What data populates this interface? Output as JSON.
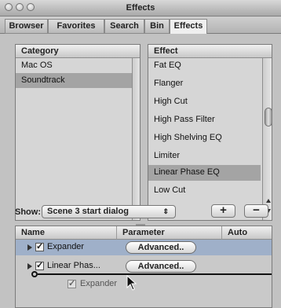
{
  "window": {
    "title": "Effects"
  },
  "tabs": [
    {
      "label": "Browser"
    },
    {
      "label": "Favorites"
    },
    {
      "label": "Search"
    },
    {
      "label": "Bin"
    },
    {
      "label": "Effects",
      "active": true
    }
  ],
  "category_list": {
    "header": "Category",
    "items": [
      "Mac OS",
      "Soundtrack"
    ],
    "selected_index": 1
  },
  "effect_list": {
    "header": "Effect",
    "items": [
      "Fat EQ",
      "Flanger",
      "High Cut",
      "High Pass Filter",
      "High Shelving EQ",
      "Limiter",
      "Linear Phase EQ",
      "Low Cut"
    ],
    "selected_index": 6
  },
  "show": {
    "label": "Show:",
    "value": "Scene 3 start dialog",
    "add_label": "+",
    "remove_label": "−"
  },
  "effects_table": {
    "headers": {
      "name": "Name",
      "parameter": "Parameter",
      "auto": "Auto"
    },
    "rows": [
      {
        "name": "Expander",
        "checked": true,
        "button": "Advanced.."
      },
      {
        "name": "Linear Phas...",
        "checked": true,
        "button": "Advanced.."
      }
    ],
    "drag_item": {
      "name": "Expander",
      "checked": true
    }
  },
  "colors": {
    "selection": "#a4a4a4",
    "effects_row_selected": "#9fb0c9"
  }
}
